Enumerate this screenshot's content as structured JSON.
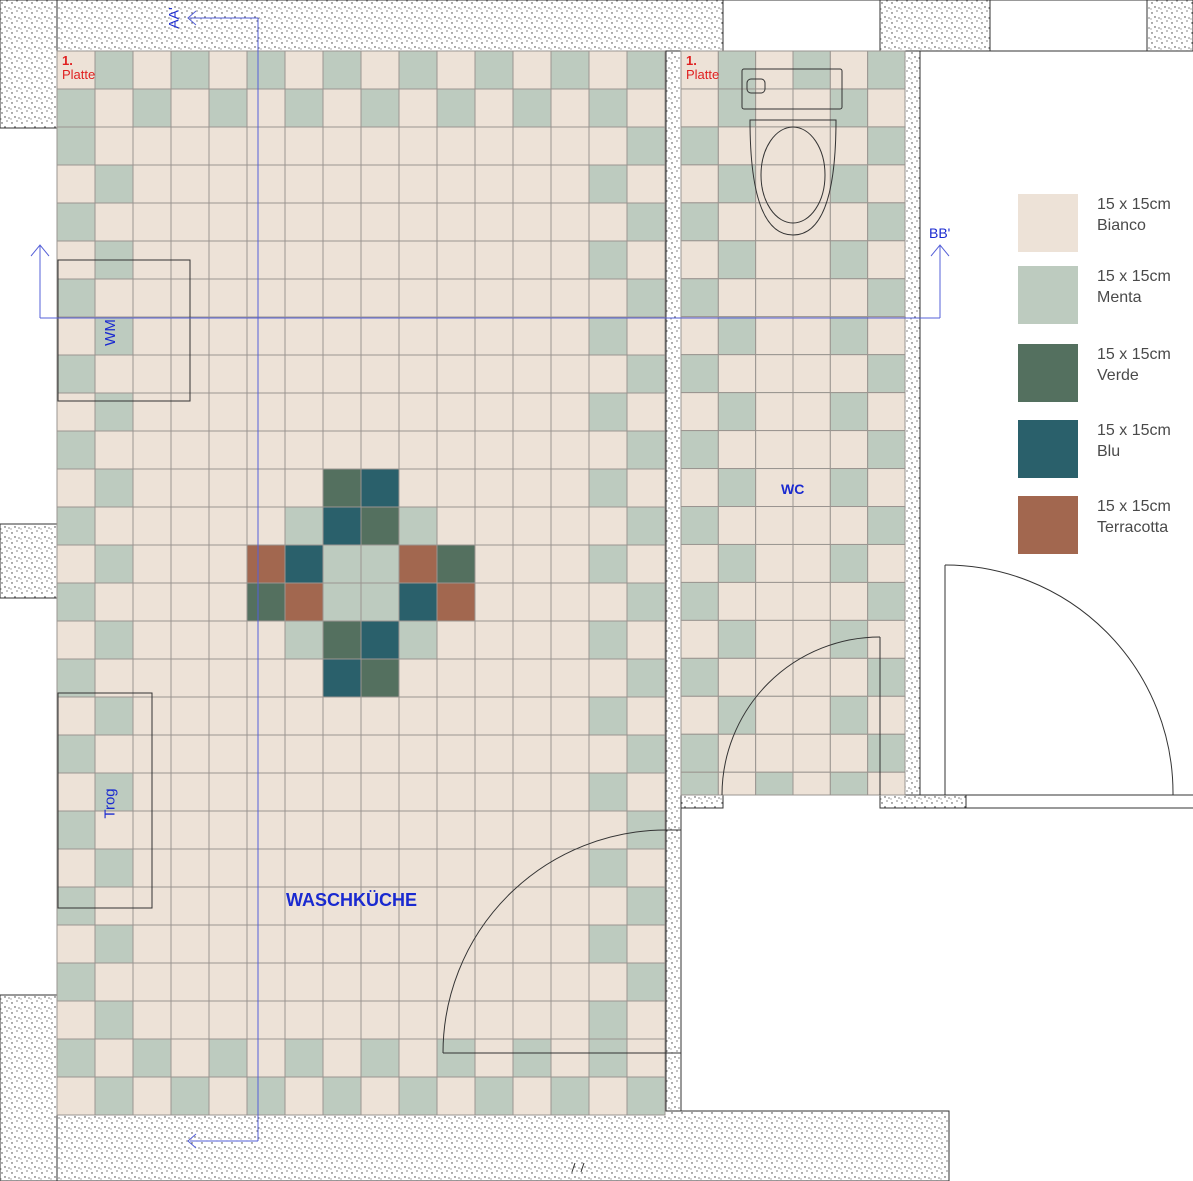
{
  "legend": [
    {
      "size": "15 x 15cm",
      "name": "Bianco",
      "color": "#ede2d7"
    },
    {
      "size": "15 x 15cm",
      "name": "Menta",
      "color": "#bdcbbf"
    },
    {
      "size": "15 x 15cm",
      "name": "Verde",
      "color": "#54705f"
    },
    {
      "size": "15 x 15cm",
      "name": "Blu",
      "color": "#2a606b"
    },
    {
      "size": "15 x 15cm",
      "name": "Terracotta",
      "color": "#a2674f"
    }
  ],
  "rooms": {
    "laundry": "WASCHKÜCHE",
    "wc": "WC"
  },
  "fixtures": {
    "washing_machine": "WM",
    "sink": "Trog"
  },
  "sections": {
    "aa": "AA'",
    "bb": "BB'"
  },
  "tile_notes": [
    {
      "number": "1.",
      "text": "Platte"
    },
    {
      "number": "1.",
      "text": "Platte"
    }
  ],
  "colors": {
    "grout": "#9a9590",
    "wall": "#333333",
    "section_line": "#5560d8",
    "label_blue": "#1a2ad0",
    "note_red": "#e02020"
  }
}
